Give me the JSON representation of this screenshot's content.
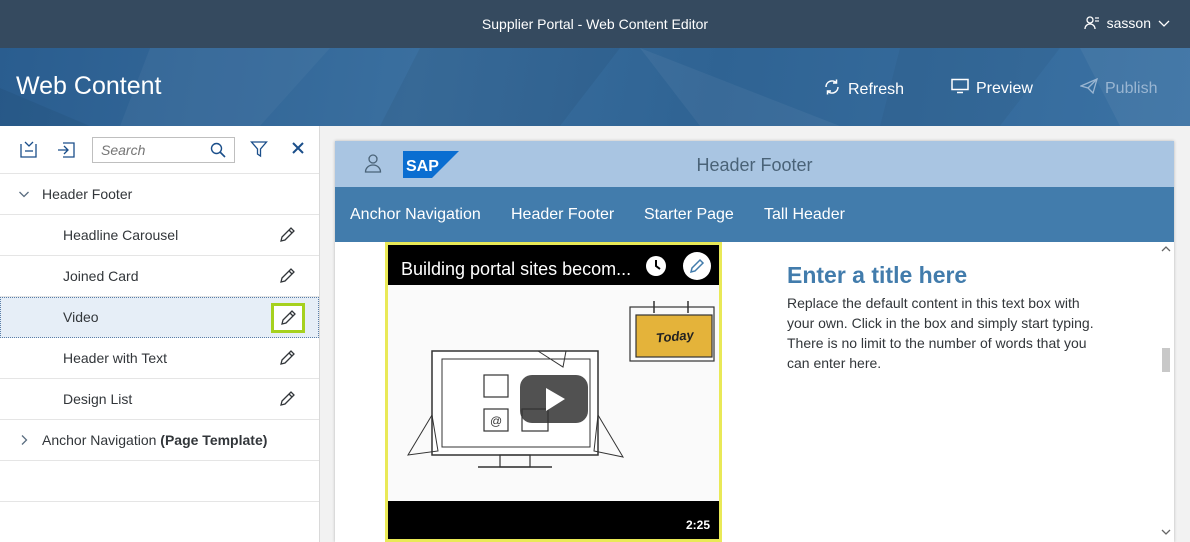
{
  "shell": {
    "title": "Supplier Portal - Web Content Editor",
    "user": "sasson",
    "icons": [
      "user-icon",
      "chevron-down-icon"
    ]
  },
  "header": {
    "title": "Web Content",
    "refresh_label": "Refresh",
    "preview_label": "Preview",
    "publish_label": "Publish"
  },
  "left_panel": {
    "search_placeholder": "Search",
    "tree": [
      {
        "label": "Header Footer",
        "expanded": true,
        "level": 0
      },
      {
        "label": "Headline Carousel",
        "level": 1
      },
      {
        "label": "Joined Card",
        "level": 1
      },
      {
        "label": "Video",
        "level": 1,
        "selected": true
      },
      {
        "label": "Header with Text",
        "level": 1
      },
      {
        "label": "Design List",
        "level": 1
      },
      {
        "label": "Anchor Navigation",
        "suffix": "(Page Template)",
        "expanded": false,
        "level": 0
      }
    ]
  },
  "page_preview": {
    "logo_text": "SAP",
    "header_title": "Header Footer",
    "nav_items": [
      "Anchor Navigation",
      "Header Footer",
      "Starter Page",
      "Tall Header"
    ],
    "video": {
      "title": "Building portal sites becom...",
      "duration": "2:25",
      "sticky_note": "Today"
    },
    "text_block": {
      "title": "Enter a title here",
      "body": "Replace the default content in this text box with your own. Click in the box and simply start typing. There is no limit to the number of words that you can enter here."
    }
  },
  "colors": {
    "shell_bg": "#354a5f",
    "header_bg": "#2f6393",
    "nav_bg": "#427cac",
    "highlight": "#a6d11f",
    "title_blue": "#427cac"
  }
}
